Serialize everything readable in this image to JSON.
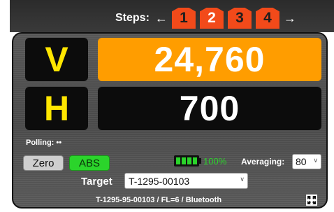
{
  "steps": {
    "label": "Steps:",
    "prev_arrow": "←",
    "next_arrow": "→",
    "items": [
      "1",
      "2",
      "3",
      "4"
    ]
  },
  "axes": {
    "v": {
      "letter": "V",
      "value": "24,760"
    },
    "h": {
      "letter": "H",
      "value": "700"
    }
  },
  "polling": {
    "label": "Polling:",
    "status": "••"
  },
  "buttons": {
    "zero": "Zero",
    "abs": "ABS"
  },
  "battery": {
    "percent": "100%",
    "level": 1.0
  },
  "averaging": {
    "label": "Averaging:",
    "value": "80"
  },
  "target": {
    "label": "Target",
    "value": "T-1295-00103"
  },
  "device_info": "T-1295-95-00103 / FL=6 / Bluetooth",
  "colors": {
    "step": "#f24a1a",
    "v_background": "#ff9d00",
    "axis_letter": "#ffe600",
    "active_green": "#2bd42b"
  },
  "icons": {
    "fullscreen": "fullscreen-icon",
    "battery": "battery-icon"
  }
}
